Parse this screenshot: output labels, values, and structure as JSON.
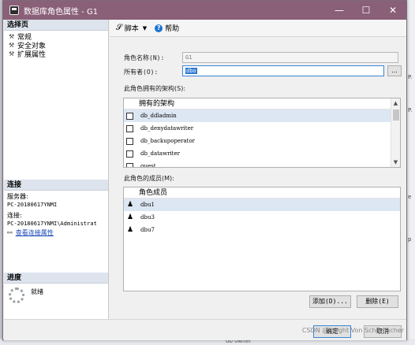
{
  "window": {
    "title": "数据库角色属性 - G1"
  },
  "title_controls": {
    "minimize": "—",
    "maximize": "☐",
    "close": "✕"
  },
  "pages": {
    "header": "选择页",
    "items": [
      {
        "label": "常规",
        "icon": "wrench-icon"
      },
      {
        "label": "安全对象",
        "icon": "wrench-icon"
      },
      {
        "label": "扩展属性",
        "icon": "wrench-icon"
      }
    ]
  },
  "connection": {
    "header": "连接",
    "server_label": "服务器:",
    "server_value": "PC-20180617YNMI",
    "conn_label": "连接:",
    "conn_value": "PC-20180617YNMI\\Administrat",
    "view_link": "查看连接属性"
  },
  "progress": {
    "header": "进度",
    "status": "就绪"
  },
  "toolbar": {
    "script_label": "脚本",
    "help_label": "帮助"
  },
  "form": {
    "role_name_label": "角色名称(N):",
    "role_name_value": "G1",
    "owner_label": "所有者(O):",
    "owner_value": "dbo",
    "browse_label": "..."
  },
  "schemas": {
    "label": "此角色拥有的架构(S):",
    "column_header": "拥有的架构",
    "rows": [
      "db_ddladmin",
      "db_denydatawriter",
      "db_backupoperator",
      "db_datawriter",
      "guest"
    ]
  },
  "members": {
    "label": "此角色的成员(M):",
    "column_header": "角色成员",
    "rows": [
      "dbu1",
      "dbu3",
      "dbu7"
    ],
    "add_button": "添加(D)...",
    "remove_button": "删除(E)"
  },
  "footer": {
    "ok_button": "确定",
    "cancel_button": "取消"
  },
  "watermark": "CSDN @Knight Von Schumacher",
  "background": {
    "fragments": [
      "P.",
      "P.",
      "e",
      "p"
    ],
    "bottom_text": "db owner"
  }
}
